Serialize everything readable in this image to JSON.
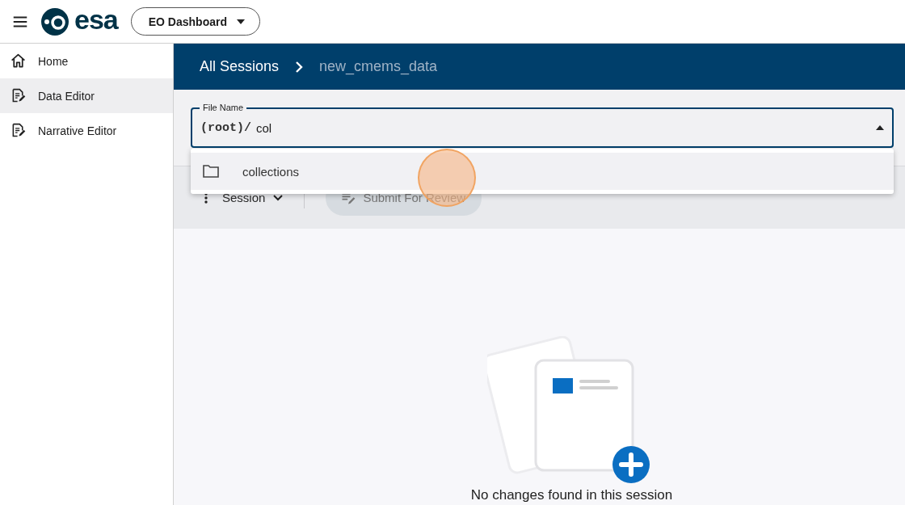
{
  "header": {
    "logo": "esa",
    "app_switcher": "EO Dashboard"
  },
  "sidebar": {
    "items": [
      {
        "label": "Home",
        "kind": "home",
        "selected": false
      },
      {
        "label": "Data Editor",
        "kind": "edit",
        "selected": true
      },
      {
        "label": "Narrative Editor",
        "kind": "edit",
        "selected": false
      }
    ]
  },
  "breadcrumb": [
    "All Sessions",
    "new_cmems_data"
  ],
  "file_field": {
    "label": "File Name",
    "prefix": "(root)/",
    "value": "col",
    "expanded": true,
    "options": [
      {
        "label": "collections",
        "selected": false
      }
    ]
  },
  "toolbar": {
    "session_menu": "Session",
    "submit_button": {
      "label": "Submit For Review",
      "disabled": true
    }
  },
  "empty_state": {
    "message": "No changes found in this session"
  },
  "click_indicator": true
}
